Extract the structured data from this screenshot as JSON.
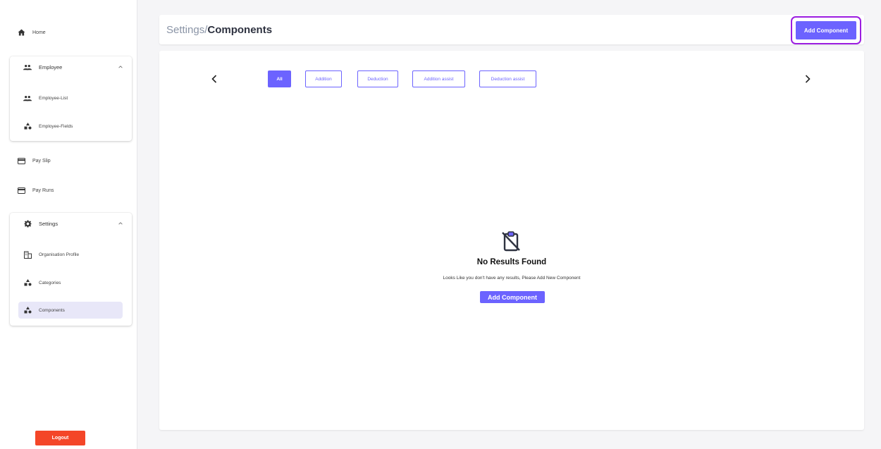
{
  "sidebar": {
    "home": {
      "label": "Home",
      "icon": "home-icon"
    },
    "employee_group": {
      "label": "Employee",
      "items": [
        {
          "label": "Employee-List",
          "icon": "people-icon"
        },
        {
          "label": "Employee-Fields",
          "icon": "shapes-icon"
        }
      ]
    },
    "pay_slip": {
      "label": "Pay Slip",
      "icon": "card-icon"
    },
    "pay_runs": {
      "label": "Pay Runs",
      "icon": "card-icon"
    },
    "settings_group": {
      "label": "Settings",
      "items": [
        {
          "label": "Organisation Profile",
          "icon": "building-icon"
        },
        {
          "label": "Categories",
          "icon": "shapes-icon"
        },
        {
          "label": "Components",
          "icon": "shapes-icon",
          "active": true
        }
      ]
    },
    "logout_label": "Logout"
  },
  "header": {
    "breadcrumb_parent": "Settings/",
    "breadcrumb_current": "Components",
    "add_button_label": "Add Component"
  },
  "filters": {
    "tabs": [
      {
        "label": "All",
        "active": true
      },
      {
        "label": "Addition"
      },
      {
        "label": "Deduction"
      },
      {
        "label": "Addition assist"
      },
      {
        "label": "Deduction assist"
      }
    ]
  },
  "empty_state": {
    "icon": "clipboard-off-icon",
    "title": "No Results Found",
    "description": "Looks Like you don't have any results, Please Add New Component",
    "button_label": "Add Component"
  },
  "colors": {
    "accent": "#6c63ff",
    "logout": "#f44628",
    "active_bg": "#e8e7f8",
    "highlight_border": "#9b1de0"
  }
}
